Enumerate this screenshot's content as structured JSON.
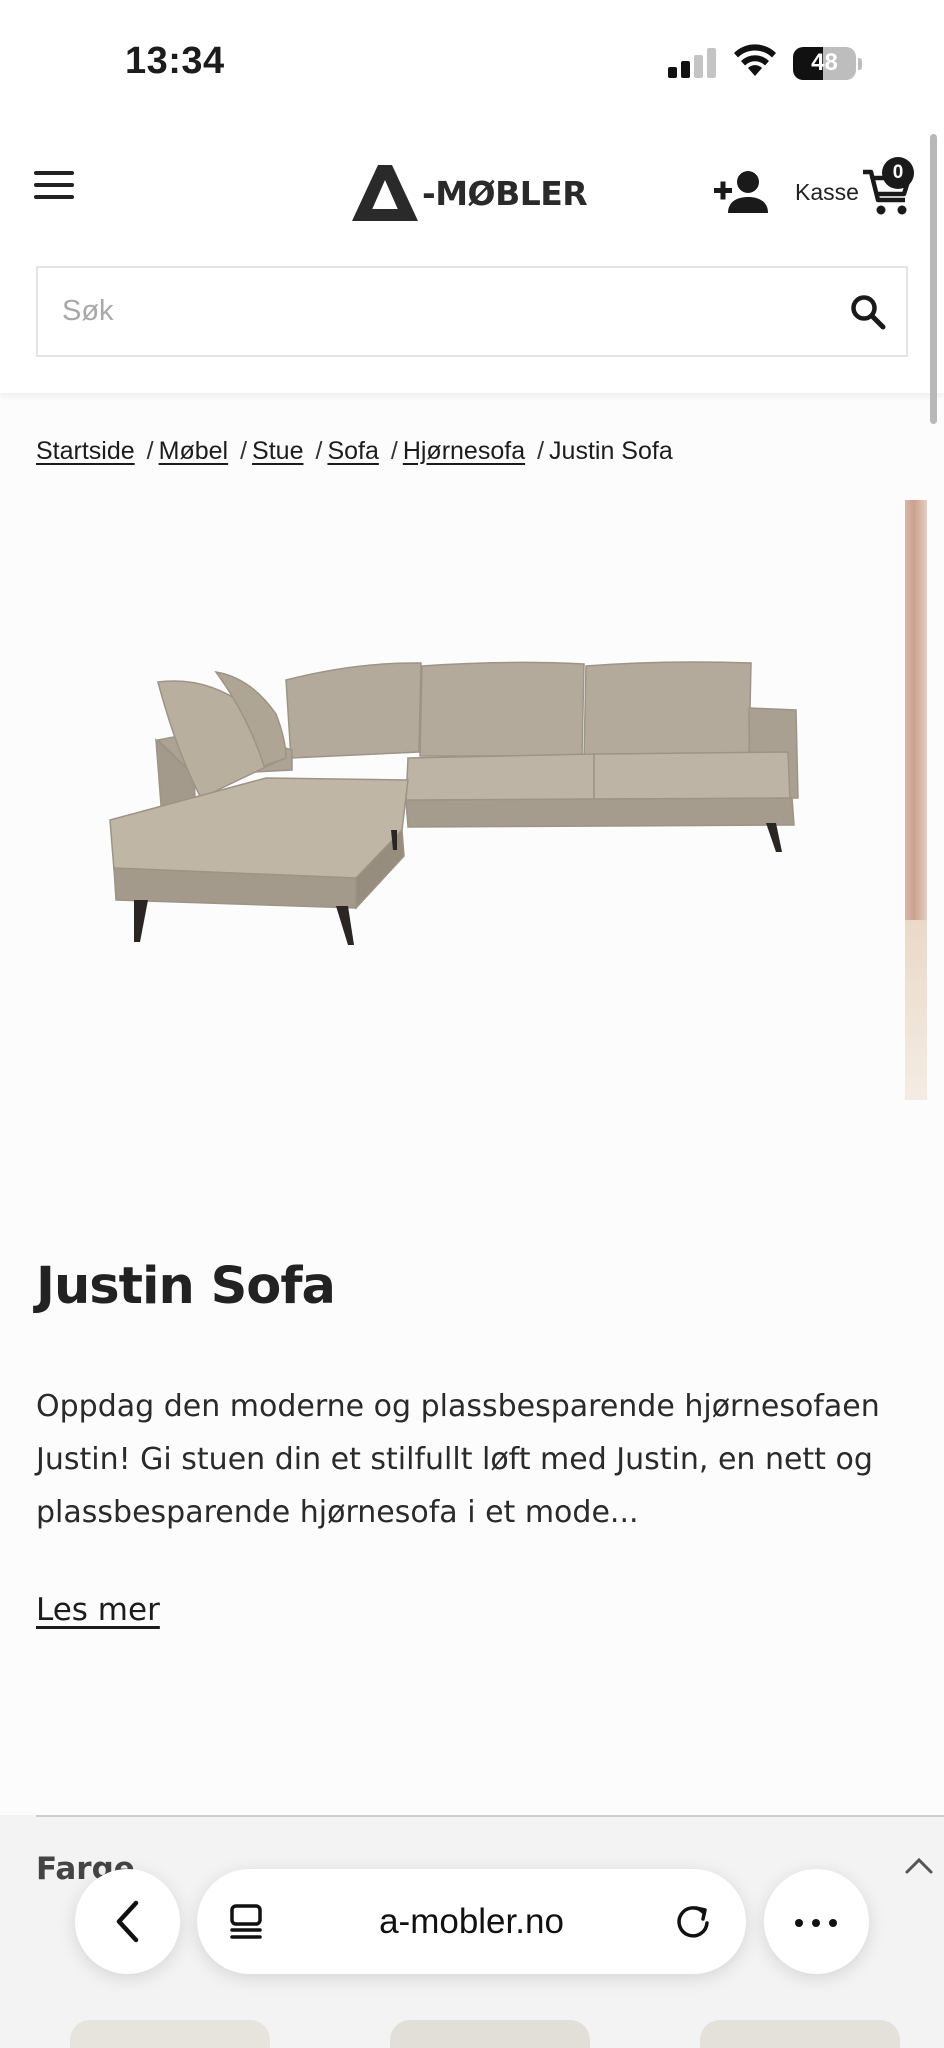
{
  "status_bar": {
    "time": "13:34",
    "battery_percent": "48",
    "battery_level": 0.48,
    "signal_bars_active": 2,
    "signal_bars_total": 4
  },
  "header": {
    "logo_text": "-MØBLER",
    "cart_label": "Kasse",
    "cart_count": "0"
  },
  "search": {
    "placeholder": "Søk",
    "value": ""
  },
  "breadcrumb": {
    "items": [
      "Startside",
      "Møbel",
      "Stue",
      "Sofa",
      "Hjørnesofa"
    ],
    "separator": "/",
    "current": "Justin Sofa"
  },
  "product": {
    "image_alt": "Justin Sofa",
    "title": "Justin Sofa",
    "description": "Oppdag den moderne og plassbesparende hjørnesofaen Justin! Gi stuen din et stilfullt løft med Justin, en nett og plassbesparende hjørnesofa i et mode...",
    "read_more": "Les mer",
    "sofa_color": "#b3aa9b"
  },
  "accordion": {
    "title": "Farge"
  },
  "browser": {
    "url": "a-mobler.no"
  },
  "icons": {
    "menu": "hamburger-icon",
    "account": "add-user-icon",
    "cart": "shopping-cart-icon",
    "search": "search-icon",
    "back": "chevron-left-icon",
    "tabs": "tabs-icon",
    "reload": "reload-icon",
    "more": "ellipsis-icon",
    "accordion": "chevron-up-icon"
  }
}
